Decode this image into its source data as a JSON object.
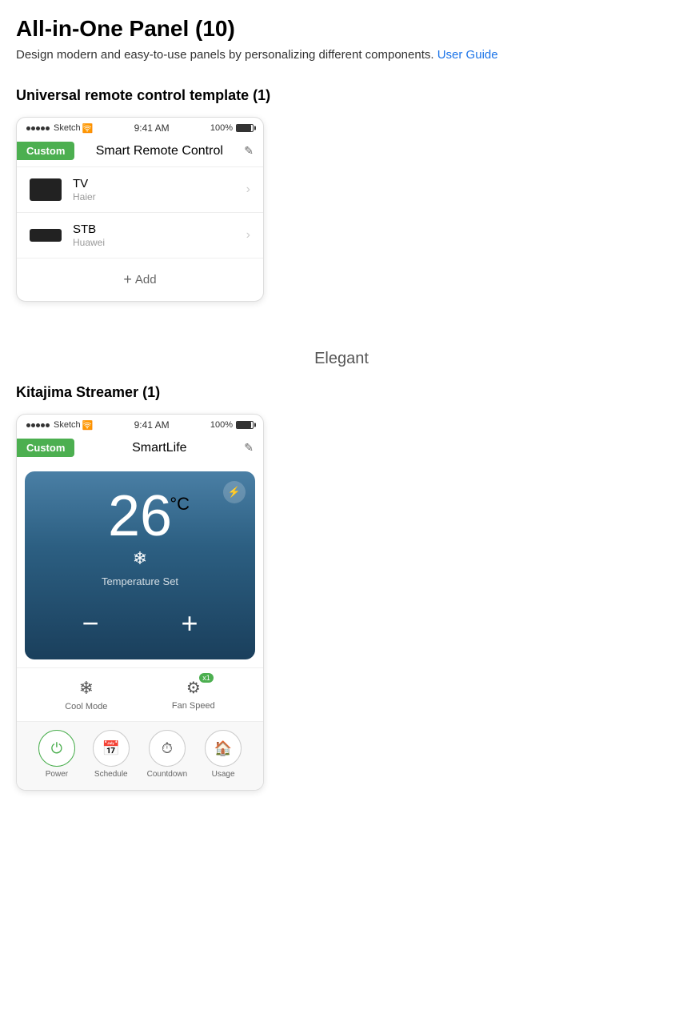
{
  "page": {
    "title": "All-in-One Panel  (10)",
    "description": "Design modern and easy-to-use panels by personalizing different components.",
    "user_guide_link": "User Guide"
  },
  "section1": {
    "title": "Universal remote control template (1)",
    "style": "Custom",
    "phone": {
      "status_bar": {
        "signal": "•••••",
        "network": "Sketch",
        "wifi": "⊙",
        "time": "9:41 AM",
        "battery_percent": "100%"
      },
      "header": {
        "custom_label": "Custom",
        "title": "Smart Remote Control",
        "edit_icon": "✎"
      },
      "devices": [
        {
          "type": "tv",
          "name": "TV",
          "brand": "Haier"
        },
        {
          "type": "stb",
          "name": "STB",
          "brand": "Huawei"
        }
      ],
      "add_button": "+ Add"
    }
  },
  "section2": {
    "style_label": "Elegant",
    "title": "Kitajima Streamer (1)",
    "phone": {
      "status_bar": {
        "signal": "•••••",
        "network": "Sketch",
        "wifi": "⊙",
        "time": "9:41 AM",
        "battery_percent": "100%"
      },
      "header": {
        "custom_label": "Custom",
        "title": "SmartLife",
        "edit_icon": "✎"
      },
      "ac": {
        "temperature": "26",
        "unit": "°C",
        "snowflake": "❄",
        "label": "Temperature Set",
        "minus_btn": "−",
        "plus_btn": "+",
        "power_icon": "⚡",
        "modes": [
          {
            "icon": "❄",
            "label": "Cool Mode",
            "badge": ""
          },
          {
            "icon": "✦✦",
            "label": "Fan Speed",
            "badge": "x1"
          }
        ],
        "bottom_controls": [
          {
            "icon": "⏻",
            "label": "Power",
            "active": true
          },
          {
            "icon": "📅",
            "label": "Schedule",
            "active": false
          },
          {
            "icon": "⏱",
            "label": "Countdown",
            "active": false
          },
          {
            "icon": "🏠",
            "label": "Usage",
            "active": false
          }
        ]
      }
    }
  }
}
